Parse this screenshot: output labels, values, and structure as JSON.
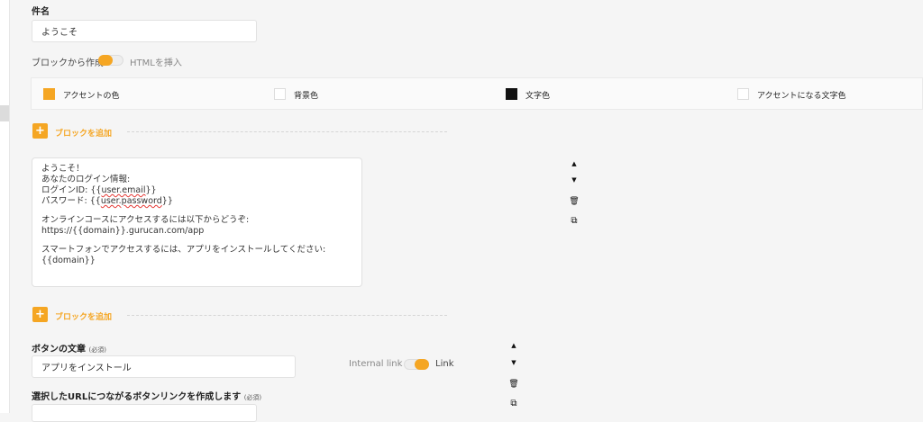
{
  "subject": {
    "label": "件名",
    "value": "ようこそ"
  },
  "mode_toggle": {
    "left_label": "ブロックから作成",
    "right_label": "HTMLを挿入"
  },
  "colors": {
    "items": [
      {
        "label": "アクセントの色",
        "color": "#f5a623"
      },
      {
        "label": "背景色",
        "color": "#ffffff"
      },
      {
        "label": "文字色",
        "color": "#111111"
      },
      {
        "label": "アクセントになる文字色",
        "color": "#ffffff"
      }
    ]
  },
  "add_block": {
    "plus": "+",
    "label": "ブロックを追加"
  },
  "text_block": {
    "lines": [
      "ようこそ！",
      "あなたのログイン情報:",
      "ログインID: {{user.email}}",
      "パスワード: {{user.password}}",
      "",
      "オンラインコースにアクセスするには以下からどうぞ:",
      "https://{{domain}}.gurucan.com/app",
      "",
      "スマートフォンでアクセスするには、アプリをインストールしてください:",
      "{{domain}}"
    ],
    "line3_prefix": "ログインID: {{",
    "line3_var": "user.email",
    "line3_suffix": "}}",
    "line4_prefix": "パスワード: {{",
    "line4_var": "user.password",
    "line4_suffix": "}}"
  },
  "block_controls": {
    "up_icon": "▲",
    "down_icon": "▼",
    "delete_icon": "🗑",
    "copy_icon": "⧉"
  },
  "button_block": {
    "text_label": "ボタンの文章",
    "required_label": "(必須)",
    "text_value": "アプリをインストール",
    "link_toggle_left": "Internal link",
    "link_toggle_right": "Link",
    "url_label": "選択したURLにつながるボタンリンクを作成します",
    "url_required_label": "(必須)"
  }
}
